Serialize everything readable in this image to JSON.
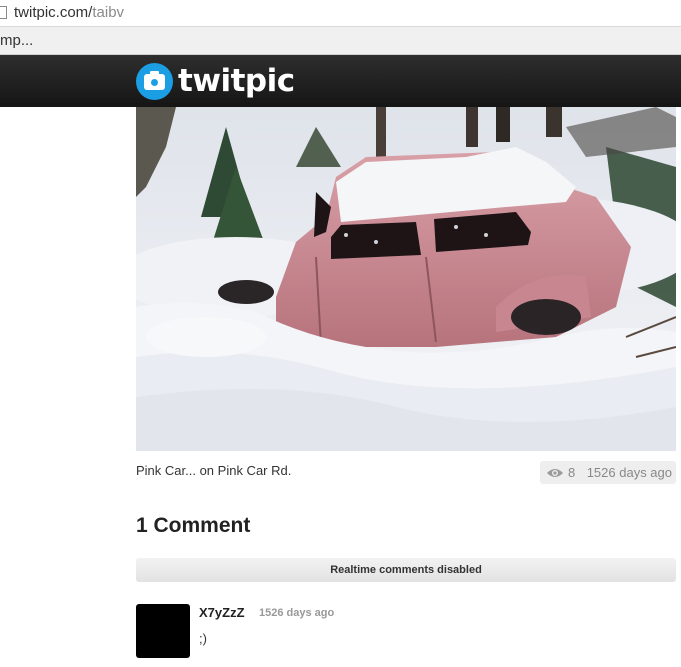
{
  "browser": {
    "url_host": "twitpic.com/",
    "url_path": "taibv",
    "bookmark_label": "mp..."
  },
  "site": {
    "logo_text": "twitpic",
    "brand_color": "#1b9ee3",
    "header_color": "#1e1e1e"
  },
  "photo": {
    "caption": "Pink Car... on Pink Car Rd.",
    "views": "8",
    "age": "1526 days ago",
    "views_icon": "eye-icon"
  },
  "comments": {
    "title": "1 Comment",
    "realtime_notice": "Realtime comments disabled",
    "items": [
      {
        "author": "X7yZzZ",
        "time": "1526 days ago",
        "text": ";)"
      }
    ]
  }
}
